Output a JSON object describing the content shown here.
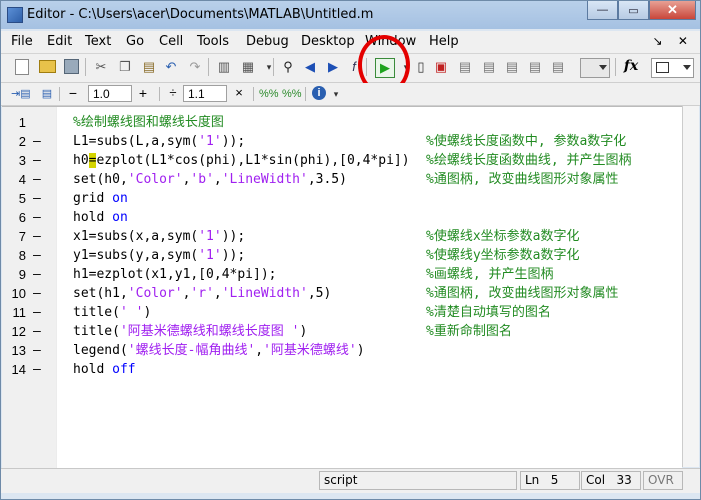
{
  "window": {
    "title": "Editor - C:\\Users\\acer\\Documents\\MATLAB\\Untitled.m",
    "minimize": "—",
    "restore": "▭",
    "close": "✕"
  },
  "menu": {
    "items": [
      "File",
      "Edit",
      "Text",
      "Go",
      "Cell",
      "Tools",
      "Debug",
      "Desktop",
      "Window",
      "Help"
    ],
    "right_icons": "↘ ✕"
  },
  "toolbar2": {
    "dec_value": "1.0",
    "inc_value": "1.1",
    "minus": "−",
    "plus": "+",
    "div": "÷",
    "x": "×"
  },
  "editor": {
    "lines": [
      {
        "num": "1",
        "dash": "",
        "code": "%绘制螺线图和螺线长度图",
        "comment": ""
      },
      {
        "num": "2",
        "dash": "–",
        "code": "L1=subs(L,a,sym('1'));",
        "comment": "%使螺线长度函数中, 参数a数字化"
      },
      {
        "num": "3",
        "dash": "–",
        "code": "h0=ezplot(L1*cos(phi),L1*sin(phi),[0,4*pi])",
        "comment": "%绘螺线长度函数曲线, 并产生图柄"
      },
      {
        "num": "4",
        "dash": "–",
        "code": "set(h0,'Color','b','LineWidth',3.5)",
        "comment": "%通图柄, 改变曲线图形对象属性"
      },
      {
        "num": "5",
        "dash": "–",
        "code": "grid on",
        "comment": ""
      },
      {
        "num": "6",
        "dash": "–",
        "code": "hold on",
        "comment": ""
      },
      {
        "num": "7",
        "dash": "–",
        "code": "x1=subs(x,a,sym('1'));",
        "comment": "%使螺线x坐标参数a数字化"
      },
      {
        "num": "8",
        "dash": "–",
        "code": "y1=subs(y,a,sym('1'));",
        "comment": "%使螺线y坐标参数a数字化"
      },
      {
        "num": "9",
        "dash": "–",
        "code": "h1=ezplot(x1,y1,[0,4*pi]);",
        "comment": "%画螺线, 并产生图柄"
      },
      {
        "num": "10",
        "dash": "–",
        "code": "set(h1,'Color','r','LineWidth',5)",
        "comment": "%通图柄, 改变曲线图形对象属性"
      },
      {
        "num": "11",
        "dash": "–",
        "code": "title(' ')",
        "comment": "%清楚自动填写的图名"
      },
      {
        "num": "12",
        "dash": "–",
        "code": "title('阿基米德螺线和螺线长度图 ')",
        "comment": "%重新命制图名"
      },
      {
        "num": "13",
        "dash": "–",
        "code": "legend('螺线长度-幅角曲线','阿基米德螺线')",
        "comment": ""
      },
      {
        "num": "14",
        "dash": "–",
        "code": "hold off",
        "comment": ""
      }
    ]
  },
  "status": {
    "mode": "script",
    "ln_label": "Ln",
    "ln_value": "5",
    "col_label": "Col",
    "col_value": "33",
    "ovr": "OVR"
  },
  "colors": {
    "comment": "#228b22",
    "string": "#a020f0",
    "keyword": "#0000ff",
    "highlight_circle": "#e40000"
  }
}
